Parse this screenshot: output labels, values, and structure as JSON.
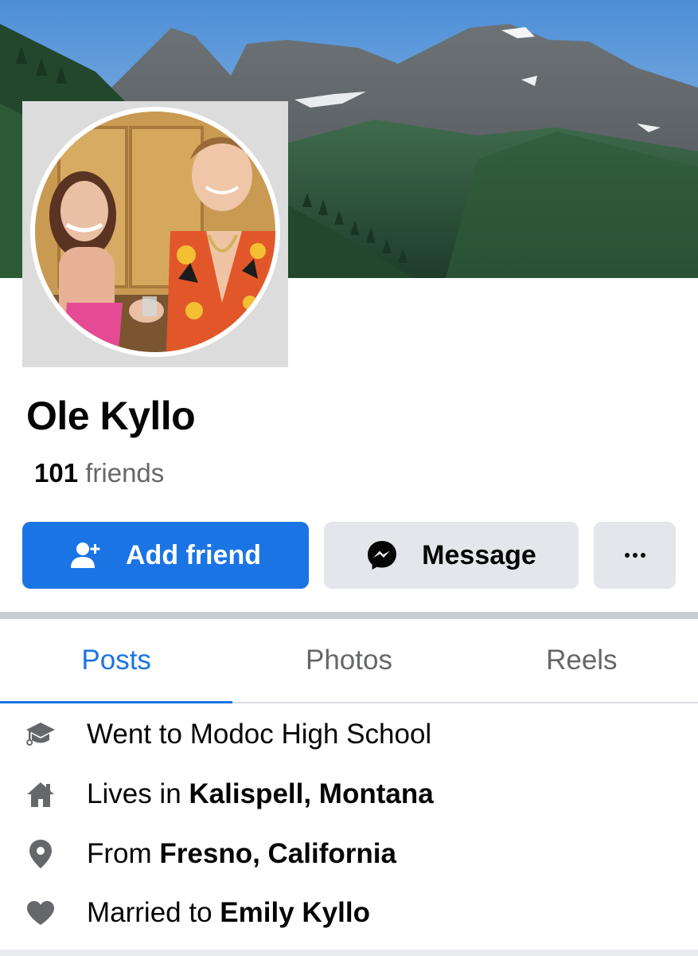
{
  "profile": {
    "name": "Ole Kyllo",
    "friends_count": "101",
    "friends_label": "friends"
  },
  "actions": {
    "add_friend_label": "Add friend",
    "message_label": "Message",
    "more_icon": "ellipsis-icon"
  },
  "tabs": [
    {
      "label": "Posts",
      "active": true
    },
    {
      "label": "Photos",
      "active": false
    },
    {
      "label": "Reels",
      "active": false
    }
  ],
  "intro": {
    "education": {
      "icon": "graduation-cap-icon",
      "prefix": "Went to Modoc High School",
      "value": ""
    },
    "lives": {
      "icon": "home-icon",
      "prefix": "Lives in ",
      "value": "Kalispell, Montana"
    },
    "from": {
      "icon": "location-pin-icon",
      "prefix": "From ",
      "value": "Fresno, California"
    },
    "relationship": {
      "icon": "heart-icon",
      "prefix": "Married to ",
      "value": "Emily Kyllo"
    }
  },
  "colors": {
    "accent": "#1b74e4",
    "secondary_button": "#e4e6eb",
    "muted_text": "#65676b"
  }
}
